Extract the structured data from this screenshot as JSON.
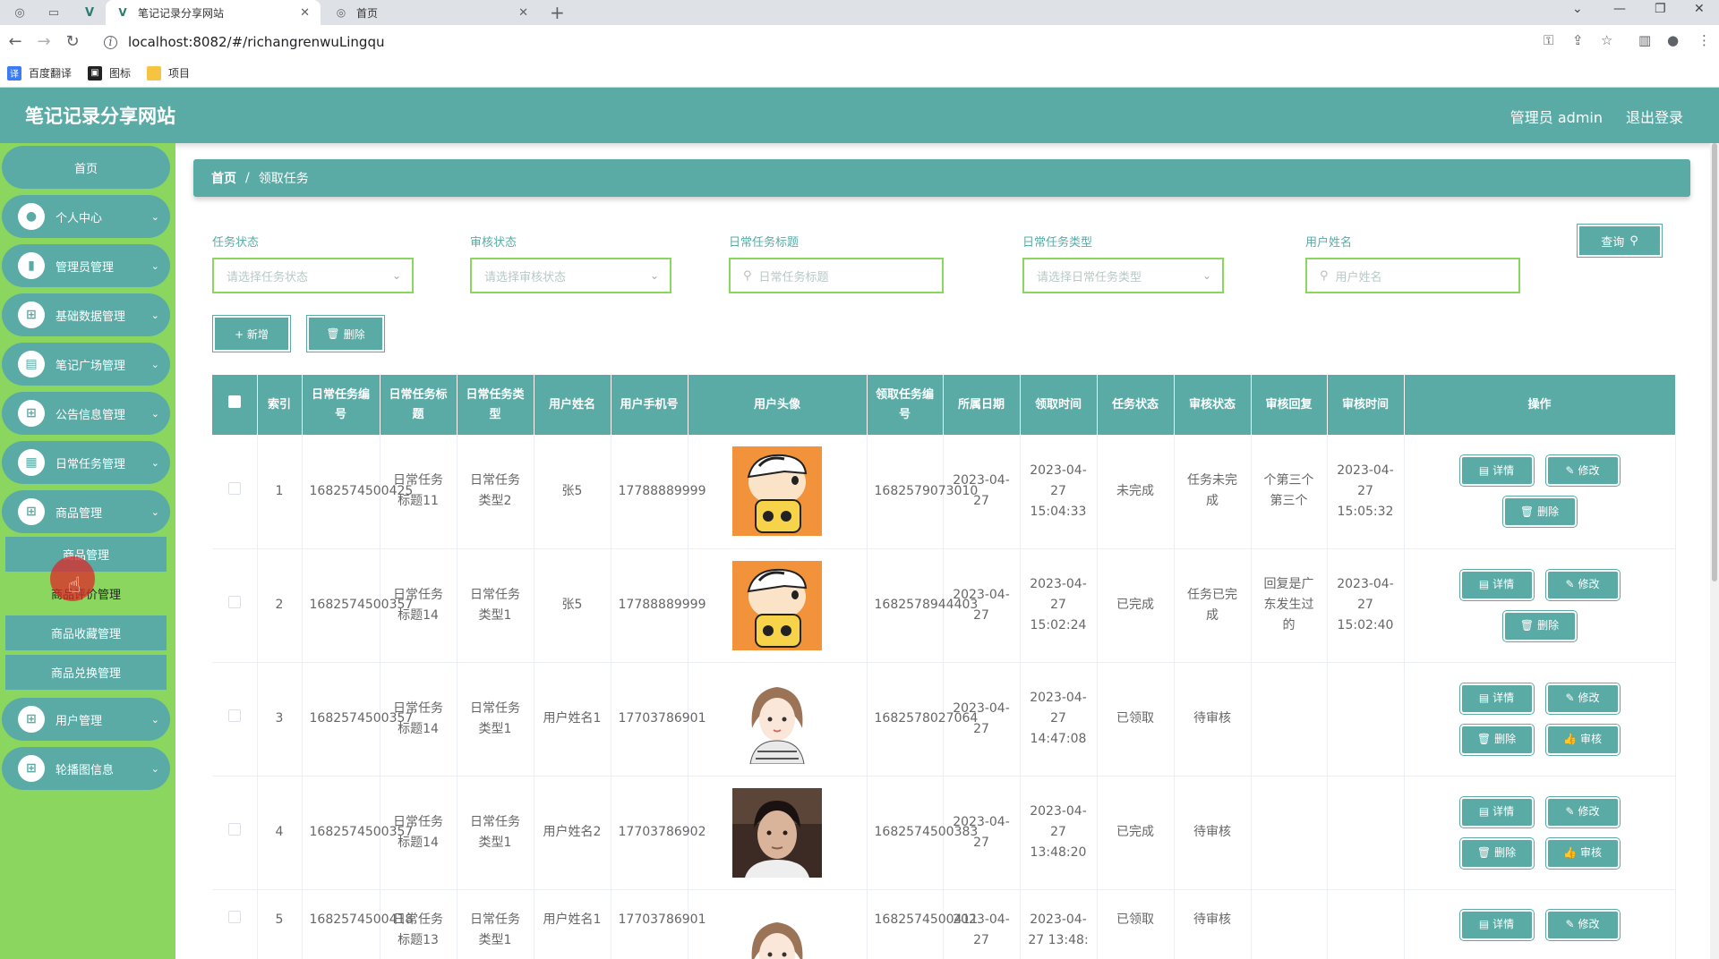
{
  "browser": {
    "tabs": [
      {
        "title": "笔记记录分享网站"
      },
      {
        "title": "首页"
      }
    ],
    "url": "localhost:8082/#/richangrenwuLingqu",
    "bookmarks": [
      "百度翻译",
      "图标",
      "项目"
    ]
  },
  "header": {
    "title": "笔记记录分享网站",
    "user": "管理员 admin",
    "logout": "退出登录"
  },
  "sidebar": {
    "home": "首页",
    "items": [
      {
        "label": "个人中心",
        "icon": "person-icon"
      },
      {
        "label": "管理员管理",
        "icon": "bar-chart-icon"
      },
      {
        "label": "基础数据管理",
        "icon": "grid-icon"
      },
      {
        "label": "笔记广场管理",
        "icon": "briefcase-icon"
      },
      {
        "label": "公告信息管理",
        "icon": "grid-icon"
      },
      {
        "label": "日常任务管理",
        "icon": "document-icon"
      },
      {
        "label": "商品管理",
        "icon": "grid-icon"
      }
    ],
    "sub_items": [
      "商品管理",
      "商品评价管理",
      "商品收藏管理",
      "商品兑换管理"
    ],
    "bottom_items": [
      {
        "label": "用户管理",
        "icon": "grid-icon"
      },
      {
        "label": "轮播图信息",
        "icon": "grid-icon"
      }
    ]
  },
  "breadcrumb": {
    "home": "首页",
    "sep": "/",
    "current": "领取任务"
  },
  "filters": {
    "task_status": {
      "label": "任务状态",
      "placeholder": "请选择任务状态"
    },
    "review_status": {
      "label": "审核状态",
      "placeholder": "请选择审核状态"
    },
    "task_title": {
      "label": "日常任务标题",
      "placeholder": "日常任务标题"
    },
    "task_type": {
      "label": "日常任务类型",
      "placeholder": "请选择日常任务类型"
    },
    "user_name": {
      "label": "用户姓名",
      "placeholder": "用户姓名"
    },
    "query": "查询"
  },
  "actions": {
    "add": "+ 新增",
    "delete": "删除"
  },
  "table": {
    "headers": [
      "索引",
      "日常任务编号",
      "日常任务标题",
      "日常任务类型",
      "用户姓名",
      "用户手机号",
      "用户头像",
      "领取任务编号",
      "所属日期",
      "领取时间",
      "任务状态",
      "审核状态",
      "审核回复",
      "审核时间",
      "操作"
    ],
    "op_labels": {
      "detail": "详情",
      "edit": "修改",
      "delete": "删除",
      "review": "审核"
    },
    "rows": [
      {
        "idx": "1",
        "task_no": "1682574500425",
        "title": "日常任务标题11",
        "type": "日常任务类型2",
        "user": "张5",
        "phone": "17788889999",
        "avatar": "cartoon-boy",
        "claim_no": "1682579073010",
        "date": "2023-04-27",
        "claim_time": "2023-04-27 15:04:33",
        "status": "未完成",
        "review": "任务未完成",
        "reply": "个第三个第三个",
        "review_time": "2023-04-27 15:05:32",
        "has_review_btn": false
      },
      {
        "idx": "2",
        "task_no": "1682574500357",
        "title": "日常任务标题14",
        "type": "日常任务类型1",
        "user": "张5",
        "phone": "17788889999",
        "avatar": "cartoon-boy",
        "claim_no": "1682578944403",
        "date": "2023-04-27",
        "claim_time": "2023-04-27 15:02:24",
        "status": "已完成",
        "review": "任务已完成",
        "reply": "回复是广东发生过的",
        "review_time": "2023-04-27 15:02:40",
        "has_review_btn": false
      },
      {
        "idx": "3",
        "task_no": "1682574500357",
        "title": "日常任务标题14",
        "type": "日常任务类型1",
        "user": "用户姓名1",
        "phone": "17703786901",
        "avatar": "girl",
        "claim_no": "1682578027064",
        "date": "2023-04-27",
        "claim_time": "2023-04-27 14:47:08",
        "status": "已领取",
        "review": "待审核",
        "reply": "",
        "review_time": "",
        "has_review_btn": true
      },
      {
        "idx": "4",
        "task_no": "1682574500357",
        "title": "日常任务标题14",
        "type": "日常任务类型1",
        "user": "用户姓名2",
        "phone": "17703786902",
        "avatar": "boy-photo",
        "claim_no": "1682574500383",
        "date": "2023-04-27",
        "claim_time": "2023-04-27 13:48:20",
        "status": "已完成",
        "review": "待审核",
        "reply": "",
        "review_time": "",
        "has_review_btn": true
      },
      {
        "idx": "5",
        "task_no": "1682574500418",
        "title": "日常任务标题13",
        "type": "日常任务类型1",
        "user": "用户姓名1",
        "phone": "17703786901",
        "avatar": "girl",
        "claim_no": "1682574500411",
        "date": "2023-04-27",
        "claim_time": "2023-04-27 13:48:",
        "status": "已领取",
        "review": "待审核",
        "reply": "",
        "review_time": "",
        "has_review_btn": false
      }
    ]
  },
  "colors": {
    "primary": "#5aaba6",
    "sidebar_bg": "#8bd65e"
  }
}
